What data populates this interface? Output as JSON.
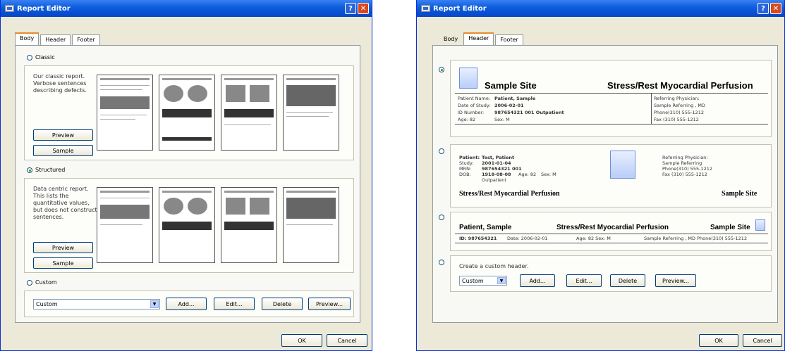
{
  "left_window": {
    "title": "Report Editor",
    "tabs": [
      "Body",
      "Header",
      "Footer"
    ],
    "options": {
      "classic": {
        "label": "Classic",
        "description": "Our classic report. Verbose sentences describing defects.",
        "preview_btn": "Preview",
        "sample_btn": "Sample"
      },
      "structured": {
        "label": "Structured",
        "description": "Data centric report. This lists the quantitative values, but does not construct sentences.",
        "preview_btn": "Preview",
        "sample_btn": "Sample"
      },
      "custom": {
        "label": "Custom"
      }
    },
    "custom_select": "Custom",
    "buttons": {
      "add": "Add...",
      "edit": "Edit...",
      "delete": "Delete",
      "preview": "Preview..."
    },
    "ok": "OK",
    "cancel": "Cancel"
  },
  "right_window": {
    "title": "Report Editor",
    "tabs": [
      "Body",
      "Header",
      "Footer"
    ],
    "header1": {
      "site": "Sample Site",
      "title": "Stress/Rest Myocardial Perfusion",
      "patient_name_label": "Patient Name:",
      "patient_name": "Patient, Sample",
      "date_label": "Date of Study:",
      "date": "2006-02-01",
      "id_label": "ID Number:",
      "id": "987654321 001 Outpatient",
      "age_label": "Age: 82",
      "sex_label": "Sex: M",
      "ref_label": "Referring Physician:",
      "ref": "Sample Referring , MD",
      "phone": "Phone(310) 555-1212",
      "fax": "Fax (310) 555-1212"
    },
    "header2": {
      "patient_label": "Patient:",
      "patient": "Test, Patient",
      "study_label": "Study:",
      "study": "2001-01-04",
      "mrn_label": "MRN:",
      "mrn": "987654321 001",
      "dob_label": "DOB:",
      "dob": "1918-08-08",
      "age": "Age: 82",
      "sex": "Sex: M",
      "outpatient": "Outpatient",
      "ref_label": "Referring Physician:",
      "ref": "Sample Referring",
      "phone": "Phone(310) 555-1212",
      "fax": "Fax (310) 555-1212",
      "title": "Stress/Rest Myocardial Perfusion",
      "site": "Sample Site"
    },
    "header3": {
      "patient": "Patient, Sample",
      "title": "Stress/Rest Myocardial Perfusion",
      "site": "Sample Site",
      "id": "ID: 987654321",
      "date": "Date: 2006-02-01",
      "agesex": "Age: 82 Sex: M",
      "ref": "Sample Referring , MD  Phone(310) 555-1212"
    },
    "custom_text": "Create a custom header.",
    "custom_select": "Custom",
    "buttons": {
      "add": "Add...",
      "edit": "Edit...",
      "delete": "Delete",
      "preview": "Preview..."
    },
    "ok": "OK",
    "cancel": "Cancel"
  },
  "colors": {
    "titlebar": "#0a5cdc",
    "dialog_bg": "#ece9d8",
    "close": "#d9481f"
  }
}
